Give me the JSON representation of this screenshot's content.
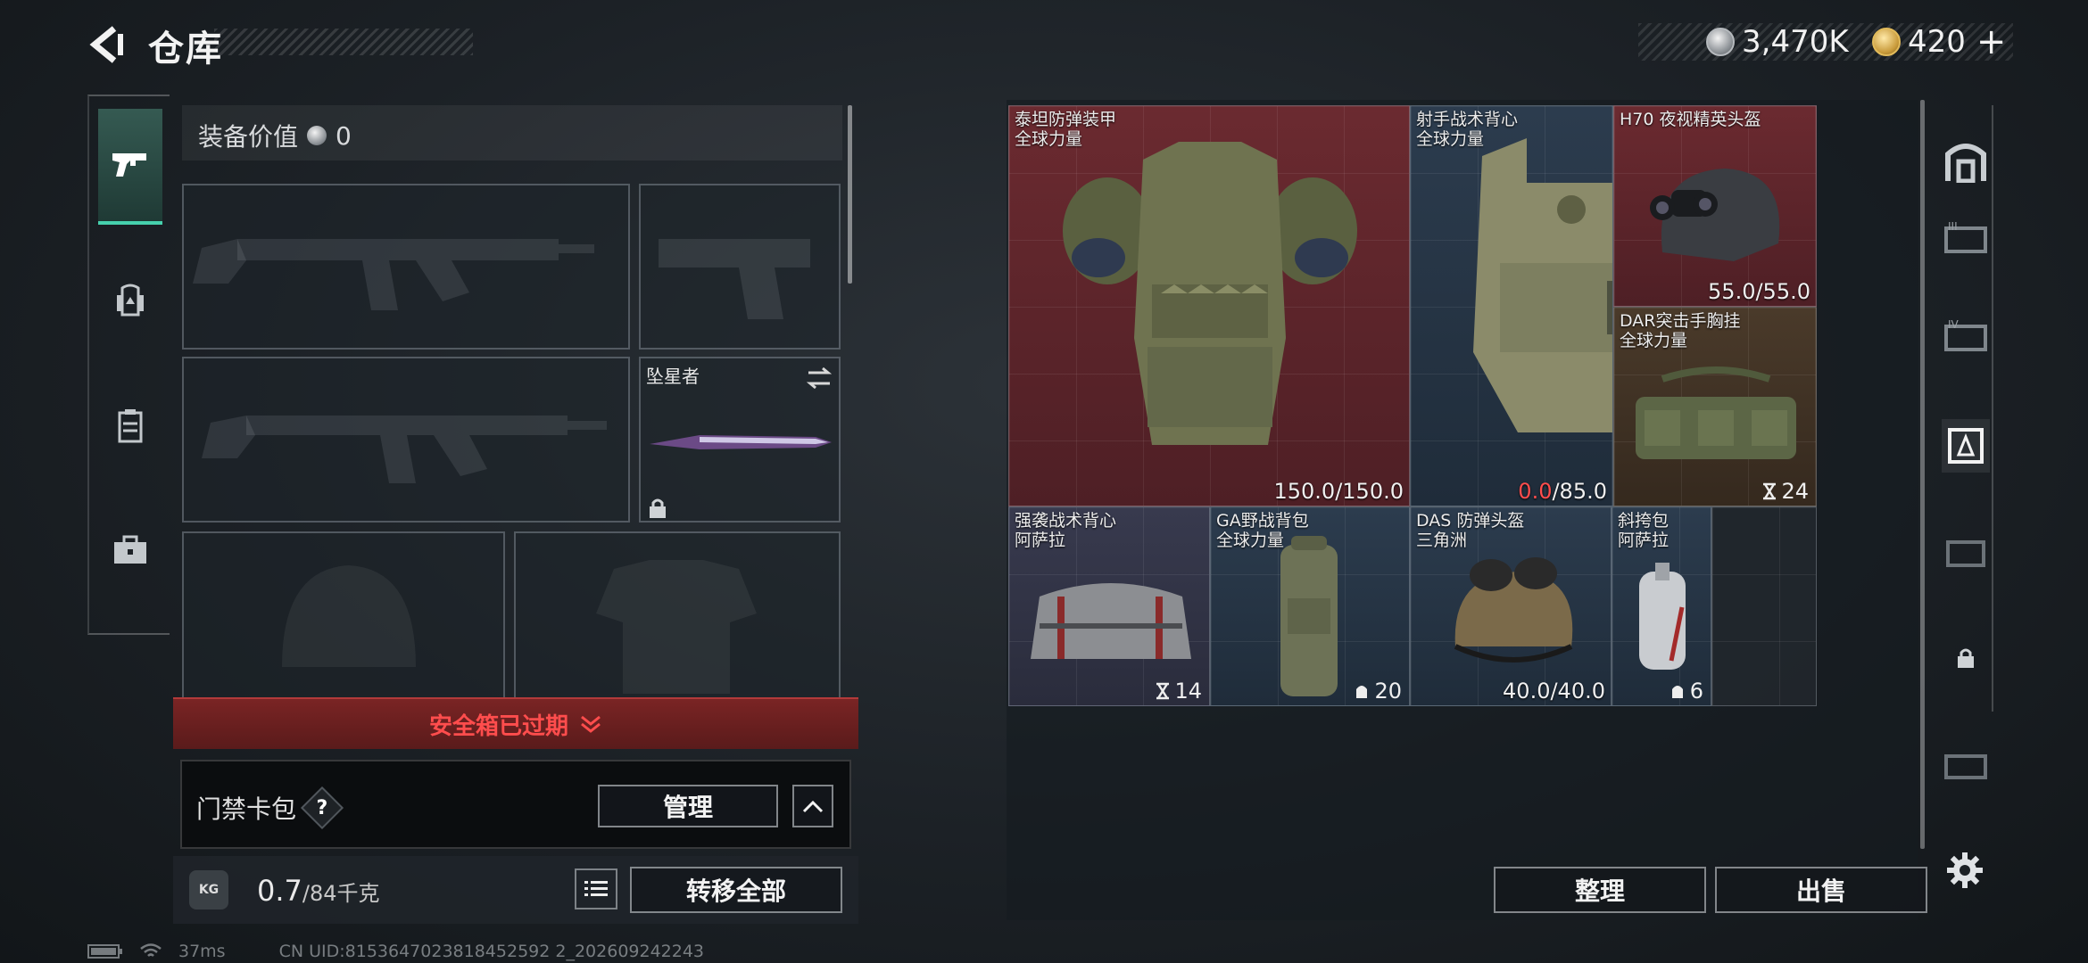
{
  "header": {
    "title": "仓库"
  },
  "currency": {
    "silver": "3,470K",
    "gold": "420"
  },
  "loadout": {
    "equipment_value_label": "装备价值",
    "equipment_value": "0",
    "melee_name": "坠星者",
    "safebox_status": "安全箱已过期",
    "access_card_label": "门禁卡包",
    "help_mark": "?",
    "manage_label": "管理",
    "weight_value": "0.7",
    "weight_max": "/84千克",
    "kg_icon_text": "KG",
    "transfer_all_label": "转移全部"
  },
  "stash": {
    "items": [
      {
        "name": "泰坦防弹装甲",
        "subtitle": "全球力量",
        "value_current": "150.0",
        "value_max": "/150.0",
        "rarity": "red"
      },
      {
        "name": "射手战术背心",
        "subtitle": "全球力量",
        "value_current": "0.0",
        "value_max": "/85.0",
        "rarity": "blue"
      },
      {
        "name": "H70 夜视精英头盔",
        "subtitle": "",
        "value_current": "55.0",
        "value_max": "/55.0",
        "rarity": "red"
      },
      {
        "name": "DAR突击手胸挂",
        "subtitle": "全球力量",
        "count": "24",
        "rarity": "gold"
      },
      {
        "name": "强袭战术背心",
        "subtitle": "阿萨拉",
        "count": "14",
        "rarity": "purple"
      },
      {
        "name": "GA野战背包",
        "subtitle": "全球力量",
        "count": "20",
        "rarity": "blue"
      },
      {
        "name": "DAS 防弹头盔",
        "subtitle": "三角洲",
        "value_current": "40.0",
        "value_max": "/40.0",
        "rarity": "blue"
      },
      {
        "name": "斜挎包",
        "subtitle": "阿萨拉",
        "count": "6",
        "rarity": "blue"
      }
    ],
    "sort_label": "整理",
    "sell_label": "出售"
  },
  "status_bar": {
    "ping": "37ms",
    "uid": "CN UID:8153647023818452592 2_202609242243"
  },
  "colors": {
    "accent": "#46d1ad",
    "danger": "#ff4d4d",
    "rarity_red": "#6b2a30",
    "rarity_gold": "#4a3a2a",
    "rarity_blue": "#2c3c4e",
    "rarity_purple": "#383a4e"
  },
  "icons": [
    "back-arrow-icon",
    "silver-coin-icon",
    "gold-coin-icon",
    "plus-icon",
    "pistol-icon",
    "backpack-icon",
    "vest-icon",
    "toolbox-icon",
    "swap-icon",
    "lock-icon",
    "chevron-down-icon",
    "chevron-up-icon",
    "list-icon",
    "settings-icon",
    "weight-icon"
  ]
}
